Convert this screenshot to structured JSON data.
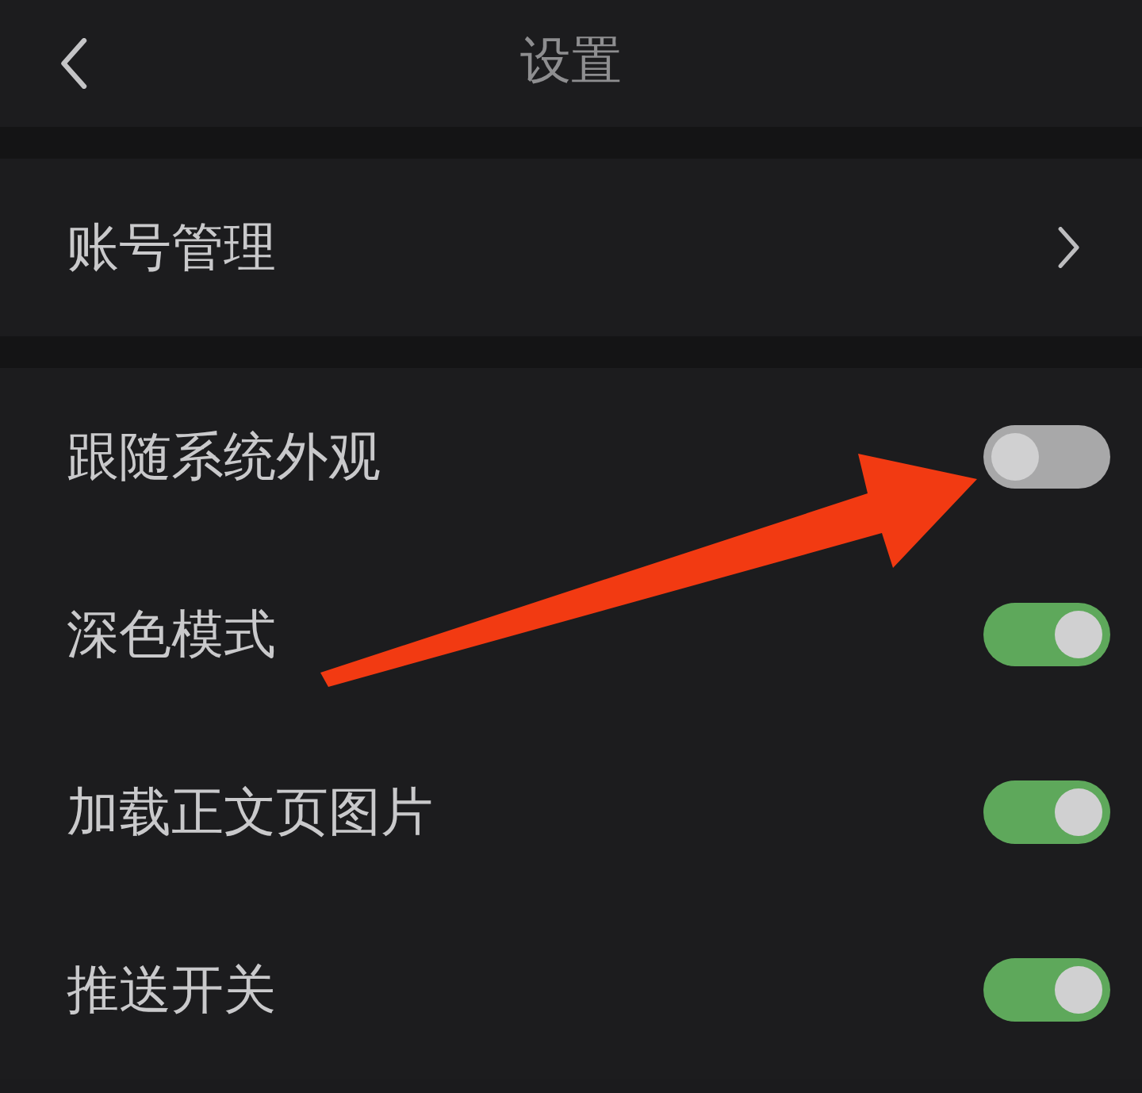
{
  "header": {
    "title": "设置"
  },
  "sections": [
    {
      "rows": [
        {
          "kind": "link",
          "label": "账号管理"
        }
      ]
    },
    {
      "rows": [
        {
          "kind": "toggle",
          "label": "跟随系统外观",
          "on": false
        },
        {
          "kind": "toggle",
          "label": "深色模式",
          "on": true
        },
        {
          "kind": "toggle",
          "label": "加载正文页图片",
          "on": true
        },
        {
          "kind": "toggle",
          "label": "推送开关",
          "on": true
        }
      ]
    }
  ]
}
